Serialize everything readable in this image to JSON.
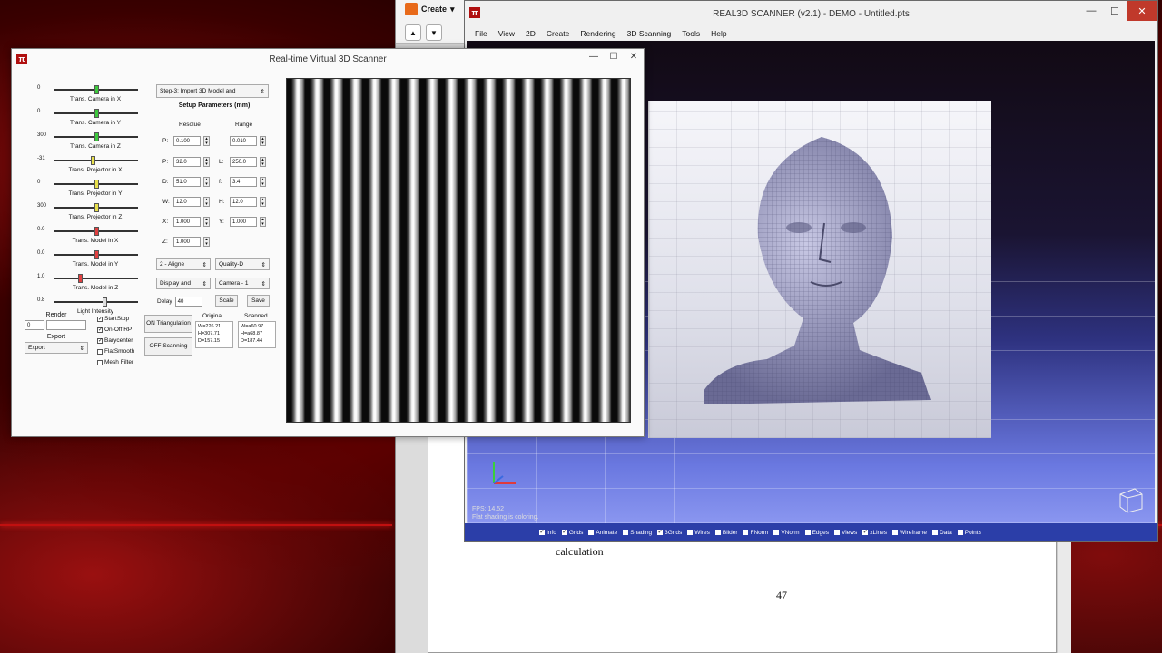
{
  "doc_window": {
    "create_label": "Create",
    "body_text": "calculation",
    "page_number": "47"
  },
  "r3d_window": {
    "title": "REAL3D SCANNER (v2.1) - DEMO - Untitled.pts",
    "menu": [
      "File",
      "View",
      "2D",
      "Create",
      "Rendering",
      "3D Scanning",
      "Tools",
      "Help"
    ],
    "fps_line": "FPS: 14.52",
    "status_line": "Flat shading is coloring.",
    "toggles": [
      {
        "label": "Info",
        "checked": true
      },
      {
        "label": "Grids",
        "checked": true
      },
      {
        "label": "Animate",
        "checked": false
      },
      {
        "label": "Shading",
        "checked": false
      },
      {
        "label": "3Grids",
        "checked": true
      },
      {
        "label": "Wires",
        "checked": false
      },
      {
        "label": "Bilder",
        "checked": false
      },
      {
        "label": "FNorm",
        "checked": false
      },
      {
        "label": "VNorm",
        "checked": false
      },
      {
        "label": "Edges",
        "checked": false
      },
      {
        "label": "Views",
        "checked": false
      },
      {
        "label": "xLines",
        "checked": true
      },
      {
        "label": "Wireframe",
        "checked": false
      },
      {
        "label": "Data",
        "checked": false
      },
      {
        "label": "Points",
        "checked": false
      }
    ]
  },
  "scanner_window": {
    "title": "Real-time Virtual 3D Scanner",
    "sliders": [
      {
        "value": "0",
        "label": "Trans. Camera in X",
        "pos": 0.5,
        "color": "#3cc83c"
      },
      {
        "value": "0",
        "label": "Trans. Camera in Y",
        "pos": 0.5,
        "color": "#3cc83c"
      },
      {
        "value": "300",
        "label": "Trans. Camera in Z",
        "pos": 0.5,
        "color": "#3cc83c"
      },
      {
        "value": "-31",
        "label": "Trans. Projector in X",
        "pos": 0.45,
        "color": "#e8e04a"
      },
      {
        "value": "0",
        "label": "Trans. Projector in Y",
        "pos": 0.5,
        "color": "#e8e04a"
      },
      {
        "value": "300",
        "label": "Trans. Projector in Z",
        "pos": 0.5,
        "color": "#e8e04a"
      },
      {
        "value": "0.0",
        "label": "Trans. Model in X",
        "pos": 0.5,
        "color": "#e04040"
      },
      {
        "value": "0.0",
        "label": "Trans. Model in Y",
        "pos": 0.5,
        "color": "#e04040"
      },
      {
        "value": "1.0",
        "label": "Trans. Model in Z",
        "pos": 0.3,
        "color": "#e04040"
      },
      {
        "value": "0.8",
        "label": "Light Intensity",
        "pos": 0.6,
        "color": "#dddddd"
      }
    ],
    "step_select": "Step-3: Import 3D Model and",
    "setup_header": "Setup Parameters (mm)",
    "col_resolution": "Resolue",
    "col_range": "Range",
    "params_left": [
      {
        "label": "P:",
        "value": "0.100"
      },
      {
        "label": "P:",
        "value": "32.0"
      },
      {
        "label": "D:",
        "value": "51.0"
      },
      {
        "label": "W:",
        "value": "12.0"
      },
      {
        "label": "X:",
        "value": "1.000"
      },
      {
        "label": "Z:",
        "value": "1.000"
      }
    ],
    "params_right": [
      {
        "label": "",
        "value": "0.010"
      },
      {
        "label": "L:",
        "value": "250.0"
      },
      {
        "label": "f:",
        "value": "3.4"
      },
      {
        "label": "H:",
        "value": "12.0"
      },
      {
        "label": "Y:",
        "value": "1.000"
      }
    ],
    "align_select": "2 - Aligne",
    "quality_select": "Quality-D",
    "display_select": "Display and",
    "camera_select": "Camera - 1",
    "delay_label": "Delay",
    "delay_value": "40",
    "scale_btn": "Scale",
    "save_btn": "Save",
    "render_label": "Render",
    "render_value": "0",
    "export_label": "Export",
    "export_select": "Export",
    "checkboxes": [
      {
        "label": "StartStop",
        "checked": true
      },
      {
        "label": "On-Off RP",
        "checked": true
      },
      {
        "label": "Barycenter",
        "checked": true
      },
      {
        "label": "FlatSmooth",
        "checked": false
      },
      {
        "label": "Mesh Filter",
        "checked": false
      }
    ],
    "triangulation_btn": "ON Triangulation",
    "scanning_btn": "OFF Scanning",
    "original_label": "Original",
    "original_lines": [
      "W=226.21",
      "H=307.71",
      "D=157.15"
    ],
    "scanned_label": "Scanned",
    "scanned_lines": [
      "W=a60.97",
      "H=a68.87",
      "D=187.44"
    ]
  }
}
